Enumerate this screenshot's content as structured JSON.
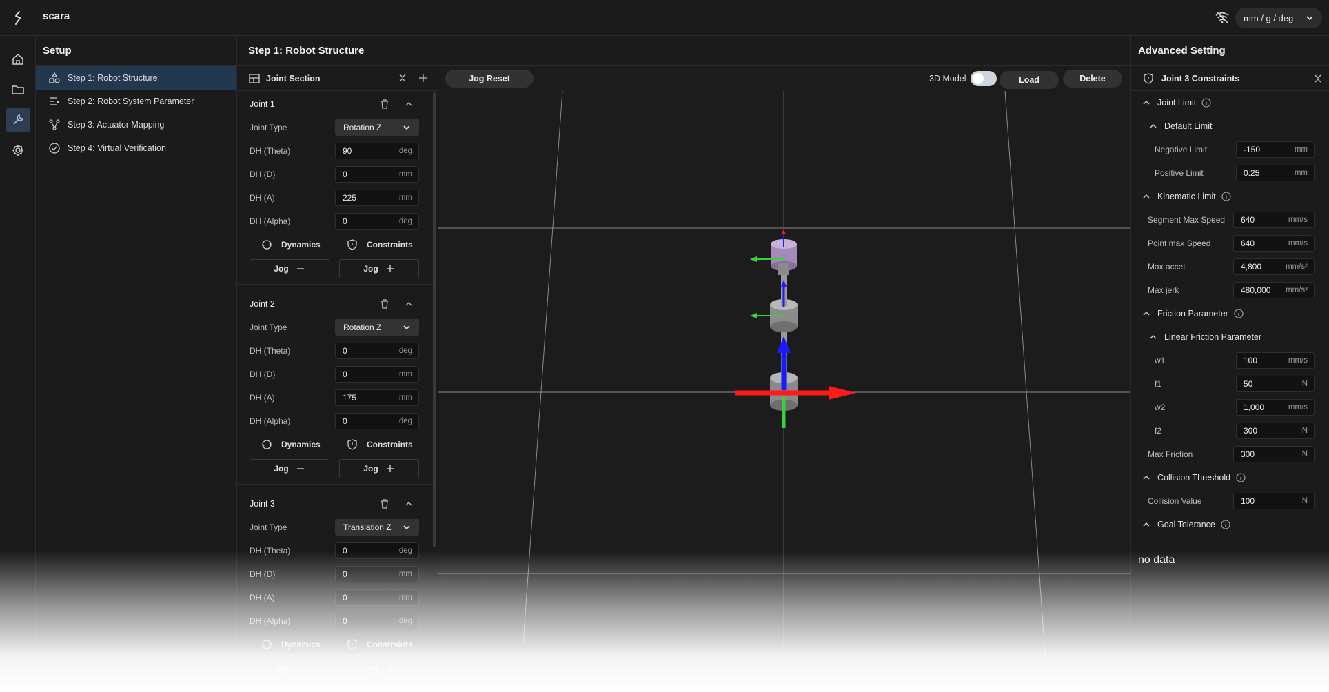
{
  "app": {
    "title": "scara",
    "unit_system": "mm / g / deg"
  },
  "setup": {
    "title": "Setup",
    "steps": [
      {
        "label": "Step 1: Robot Structure",
        "active": true
      },
      {
        "label": "Step 2: Robot System Parameter"
      },
      {
        "label": "Step 3: Actuator Mapping"
      },
      {
        "label": "Step 4: Virtual Verification"
      }
    ]
  },
  "main": {
    "title": "Step 1: Robot Structure"
  },
  "joint_section": {
    "title": "Joint Section",
    "joints": [
      {
        "name": "Joint 1",
        "type_label": "Joint Type",
        "type": "Rotation Z",
        "params": [
          {
            "label": "DH (Theta)",
            "value": "90",
            "unit": "deg"
          },
          {
            "label": "DH (D)",
            "value": "0",
            "unit": "mm"
          },
          {
            "label": "DH (A)",
            "value": "225",
            "unit": "mm"
          },
          {
            "label": "DH (Alpha)",
            "value": "0",
            "unit": "deg"
          }
        ],
        "dynamics": "Dynamics",
        "constraints": "Constraints",
        "jog_minus": "Jog",
        "jog_plus": "Jog"
      },
      {
        "name": "Joint 2",
        "type_label": "Joint Type",
        "type": "Rotation Z",
        "params": [
          {
            "label": "DH (Theta)",
            "value": "0",
            "unit": "deg"
          },
          {
            "label": "DH (D)",
            "value": "0",
            "unit": "mm"
          },
          {
            "label": "DH (A)",
            "value": "175",
            "unit": "mm"
          },
          {
            "label": "DH (Alpha)",
            "value": "0",
            "unit": "deg"
          }
        ],
        "dynamics": "Dynamics",
        "constraints": "Constraints",
        "jog_minus": "Jog",
        "jog_plus": "Jog"
      },
      {
        "name": "Joint 3",
        "type_label": "Joint Type",
        "type": "Translation Z",
        "params": [
          {
            "label": "DH (Theta)",
            "value": "0",
            "unit": "deg"
          },
          {
            "label": "DH (D)",
            "value": "0",
            "unit": "mm"
          },
          {
            "label": "DH (A)",
            "value": "0",
            "unit": "mm"
          },
          {
            "label": "DH (Alpha)",
            "value": "0",
            "unit": "deg"
          }
        ],
        "dynamics": "Dynamics",
        "constraints": "Constraints",
        "jog_minus": "Jog",
        "jog_plus": "Jog"
      }
    ]
  },
  "viewport": {
    "jog_reset": "Jog Reset",
    "model_toggle": "3D Model",
    "model_on": true,
    "load": "Load",
    "delete": "Delete"
  },
  "advanced": {
    "title": "Advanced Setting",
    "constraints_title": "Joint 3 Constraints",
    "joint_limit": {
      "title": "Joint Limit",
      "default_limit": "Default Limit",
      "negative": {
        "label": "Negative Limit",
        "value": "-150",
        "unit": "mm"
      },
      "positive": {
        "label": "Positive Limit",
        "value": "0.25",
        "unit": "mm"
      }
    },
    "kinematic_limit": {
      "title": "Kinematic Limit",
      "rows": [
        {
          "label": "Segment Max Speed",
          "value": "640",
          "unit": "mm/s"
        },
        {
          "label": "Point max Speed",
          "value": "640",
          "unit": "mm/s"
        },
        {
          "label": "Max accel",
          "value": "4,800",
          "unit": "mm/s²"
        },
        {
          "label": "Max jerk",
          "value": "480,000",
          "unit": "mm/s³"
        }
      ]
    },
    "friction": {
      "title": "Friction Parameter",
      "linear_title": "Linear Friction Parameter",
      "rows": [
        {
          "label": "w1",
          "value": "100",
          "unit": "mm/s"
        },
        {
          "label": "f1",
          "value": "50",
          "unit": "N"
        },
        {
          "label": "w2",
          "value": "1,000",
          "unit": "mm/s"
        },
        {
          "label": "f2",
          "value": "300",
          "unit": "N"
        }
      ],
      "max": {
        "label": "Max Friction",
        "value": "300",
        "unit": "N"
      }
    },
    "collision": {
      "title": "Collision Threshold",
      "value": {
        "label": "Collision Value",
        "value": "100",
        "unit": "N"
      }
    },
    "goal_tolerance": {
      "title": "Goal Tolerance",
      "empty": "no data"
    }
  },
  "colors": {
    "accent": "#22384f",
    "x_axis": "#ff1a1a",
    "y_axis": "#3ad13a",
    "z_axis": "#1a1aff"
  }
}
